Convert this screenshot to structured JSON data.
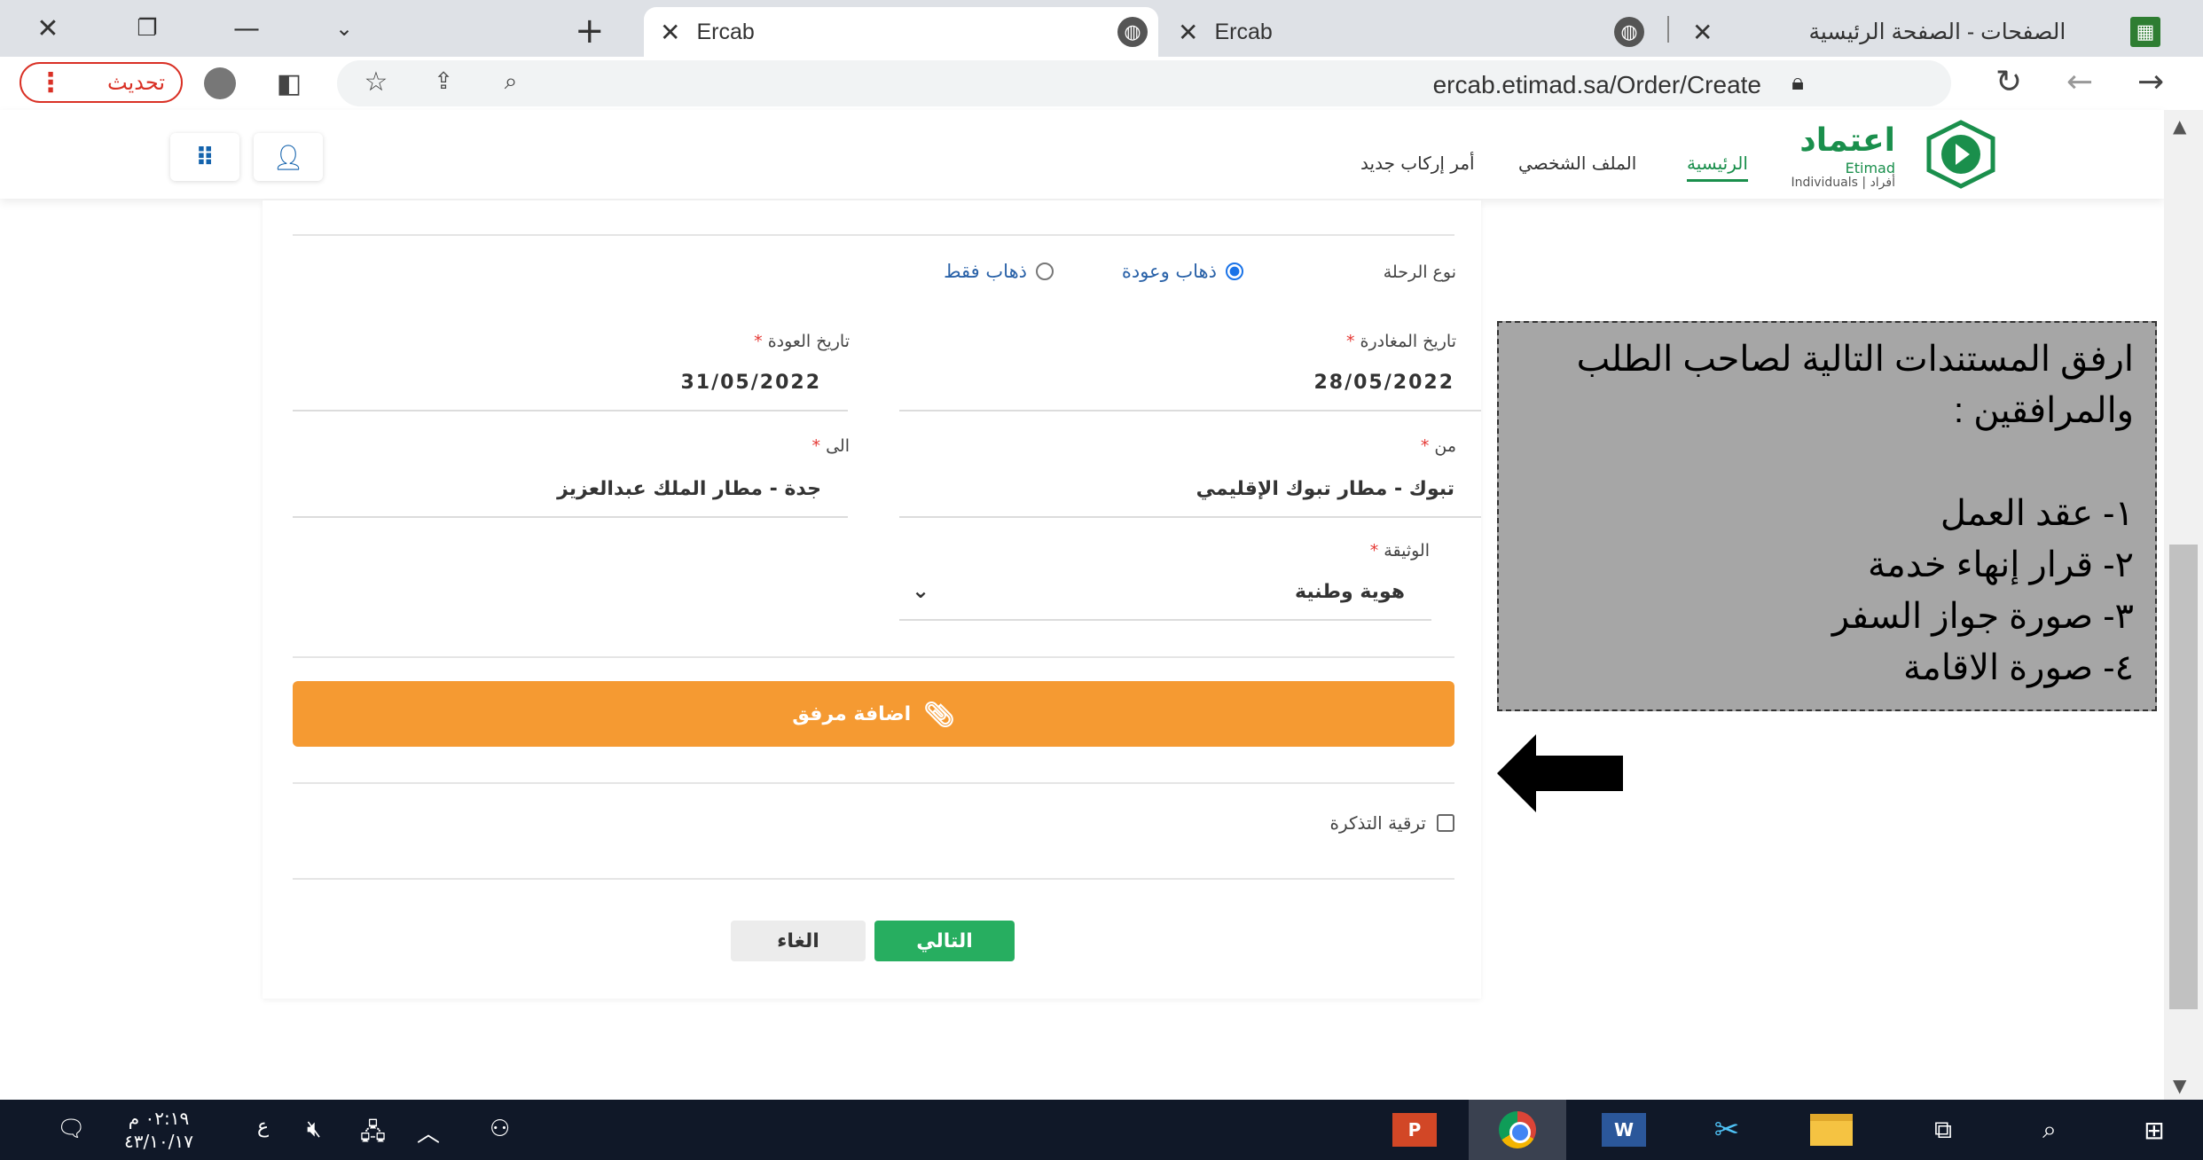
{
  "browser": {
    "tabs": [
      {
        "title": "الصفحات - الصفحة الرئيسية",
        "active": false
      },
      {
        "title": "Ercab",
        "active": false
      },
      {
        "title": "Ercab",
        "active": true
      }
    ],
    "url": "ercab.etimad.sa/Order/Create",
    "update_label": "تحديث"
  },
  "site": {
    "logo_ar": "اعتماد",
    "logo_en": "Etimad",
    "logo_sub": "Individuals | أفراد",
    "nav": {
      "home": "الرئيسية",
      "profile": "الملف الشخصي",
      "new_order": "أمر إركاب جديد"
    }
  },
  "form": {
    "trip_type_label": "نوع الرحلة",
    "trip_options": [
      {
        "label": "ذهاب وعودة",
        "selected": true
      },
      {
        "label": "ذهاب فقط",
        "selected": false
      }
    ],
    "departure_label": "تاريخ المغادرة",
    "departure_value": "28/05/2022",
    "return_label": "تاريخ العودة",
    "return_value": "31/05/2022",
    "from_label": "من",
    "from_value": "تبوك - مطار تبوك الإقليمي",
    "to_label": "الى",
    "to_value": "جدة - مطار الملك عبدالعزيز",
    "document_label": "الوثيقة",
    "document_value": "هوية وطنية",
    "required_mark": "*",
    "attach_label": "اضافة مرفق",
    "upgrade_label": "ترقية التذكرة",
    "next_label": "التالي",
    "cancel_label": "الغاء"
  },
  "callout": {
    "intro_line1": "ارفق المستندات التالية لصاحب الطلب",
    "intro_line2": "والمرافقين :",
    "items": [
      "١- عقد العمل",
      "٢- قرار إنهاء خدمة",
      "٣- صورة جواز السفر",
      "٤- صورة الاقامة"
    ]
  },
  "taskbar": {
    "time": "٠٢:١٩ م",
    "date": "٤٣/١٠/١٧",
    "lang": "ع"
  },
  "colors": {
    "brand_green": "#1a8f4c",
    "attach_orange": "#f59a32",
    "next_green": "#27ae60",
    "required_red": "#e53935",
    "callout_gray": "#a6a6a6"
  }
}
